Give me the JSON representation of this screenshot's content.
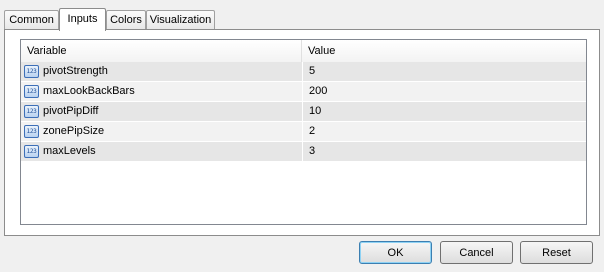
{
  "tabs": [
    {
      "label": "Common"
    },
    {
      "label": "Inputs"
    },
    {
      "label": "Colors"
    },
    {
      "label": "Visualization"
    }
  ],
  "active_tab": "Inputs",
  "grid": {
    "columns": {
      "variable": "Variable",
      "value": "Value"
    },
    "type_icon_text": "123",
    "rows": [
      {
        "name": "pivotStrength",
        "value": "5"
      },
      {
        "name": "maxLookBackBars",
        "value": "200"
      },
      {
        "name": "pivotPipDiff",
        "value": "10"
      },
      {
        "name": "zonePipSize",
        "value": "2"
      },
      {
        "name": "maxLevels",
        "value": "3"
      }
    ]
  },
  "buttons": {
    "ok": "OK",
    "cancel": "Cancel",
    "reset": "Reset"
  }
}
